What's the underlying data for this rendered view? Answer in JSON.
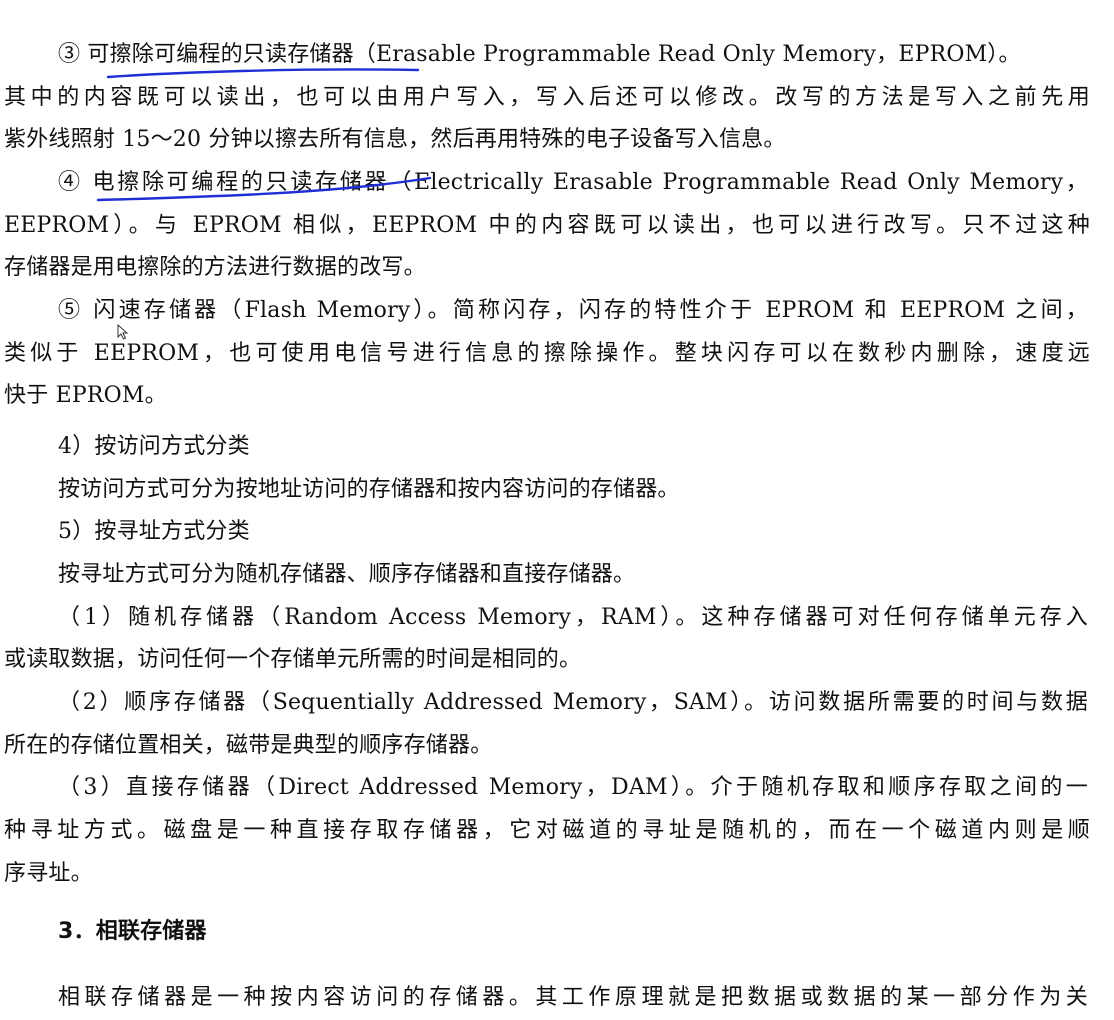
{
  "document": {
    "lines": [
      {
        "text": "③ 可擦除可编程的只读存储器（Erasable Programmable Read Only Memory，EPROM）。"
      },
      {
        "text": "其中的内容既可以读出，也可以由用户写入，写入后还可以修改。改写的方法是写入之前先用"
      },
      {
        "text": "紫外线照射 15～20 分钟以擦去所有信息，然后再用特殊的电子设备写入信息。"
      },
      {
        "text": "④ 电擦除可编程的只读存储器（Electrically Erasable Programmable Read Only Memory，"
      },
      {
        "text": "EEPROM）。与 EPROM 相似，EEPROM 中的内容既可以读出，也可以进行改写。只不过这种"
      },
      {
        "text": "存储器是用电擦除的方法进行数据的改写。"
      },
      {
        "text": "⑤ 闪速存储器（Flash Memory）。简称闪存，闪存的特性介于 EPROM 和 EEPROM 之间，"
      },
      {
        "text": "类似于 EEPROM，也可使用电信号进行信息的擦除操作。整块闪存可以在数秒内删除，速度远"
      },
      {
        "text": "快于 EPROM。"
      },
      {
        "text": "4）按访问方式分类"
      },
      {
        "text": "按访问方式可分为按地址访问的存储器和按内容访问的存储器。"
      },
      {
        "text": "5）按寻址方式分类"
      },
      {
        "text": "按寻址方式可分为随机存储器、顺序存储器和直接存储器。"
      },
      {
        "text": "（1）随机存储器（Random Access Memory，RAM）。这种存储器可对任何存储单元存入"
      },
      {
        "text": "或读取数据，访问任何一个存储单元所需的时间是相同的。"
      },
      {
        "text": "（2）顺序存储器（Sequentially Addressed Memory，SAM）。访问数据所需要的时间与数据"
      },
      {
        "text": "所在的存储位置相关，磁带是典型的顺序存储器。"
      },
      {
        "text": "（3）直接存储器（Direct Addressed Memory，DAM）。介于随机存取和顺序存取之间的一"
      },
      {
        "text": "种寻址方式。磁盘是一种直接存取存储器，它对磁道的寻址是随机的，而在一个磁道内则是顺"
      },
      {
        "text": "序寻址。"
      },
      {
        "text": "3．相联存储器"
      },
      {
        "text": "相联存储器是一种按内容访问的存储器。其工作原理就是把数据或数据的某一部分作为关"
      }
    ]
  },
  "annotation_color": "#1f2fd6"
}
